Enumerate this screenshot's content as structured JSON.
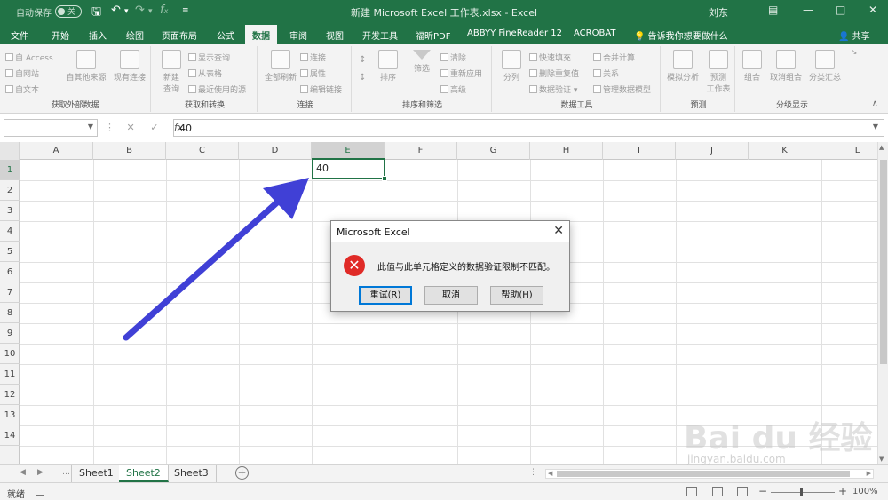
{
  "titlebar": {
    "autosave_label": "自动保存",
    "autosave_state": "关",
    "document_title": "新建 Microsoft Excel 工作表.xlsx  -  Excel",
    "user": "刘东",
    "icons": [
      "save-icon",
      "undo-icon",
      "redo-icon",
      "function-icon",
      "customize-icon"
    ]
  },
  "ribbon": {
    "tabs": [
      {
        "label": "文件"
      },
      {
        "label": "开始"
      },
      {
        "label": "插入"
      },
      {
        "label": "绘图"
      },
      {
        "label": "页面布局"
      },
      {
        "label": "公式"
      },
      {
        "label": "数据",
        "active": true
      },
      {
        "label": "审阅"
      },
      {
        "label": "视图"
      },
      {
        "label": "开发工具"
      },
      {
        "label": "福昕PDF"
      },
      {
        "label": "ABBYY FineReader 12"
      },
      {
        "label": "ACROBAT"
      }
    ],
    "tell_me": "告诉我你想要做什么",
    "share": "共享",
    "groups": {
      "external": {
        "label": "获取外部数据",
        "access": "自 Access",
        "web": "自网站",
        "text": "自文本",
        "other": "自其他来源",
        "existing": "现有连接"
      },
      "transform": {
        "label": "获取和转换",
        "new_query": "新建\n查询",
        "new_query_l1": "新建",
        "new_query_l2": "查询",
        "show_queries": "显示查询",
        "from_table": "从表格",
        "recent": "最近使用的源"
      },
      "connections": {
        "label": "连接",
        "refresh_all": "全部刷新",
        "connections": "连接",
        "properties": "属性",
        "edit_links": "编辑链接"
      },
      "sort": {
        "label": "排序和筛选",
        "sort": "排序",
        "filter": "筛选",
        "clear": "清除",
        "reapply": "重新应用",
        "advanced": "高级"
      },
      "tools": {
        "label": "数据工具",
        "split": "分列",
        "flash_fill": "快速填充",
        "remove_dup": "删除重复值",
        "validation": "数据验证",
        "consolidate": "合并计算",
        "relations": "关系",
        "data_model": "管理数据模型"
      },
      "forecast": {
        "label": "预测",
        "whatif": "模拟分析",
        "sheet_l1": "预测",
        "sheet_l2": "工作表"
      },
      "outline": {
        "label": "分级显示",
        "group": "组合",
        "ungroup": "取消组合",
        "subtotal": "分类汇总"
      }
    }
  },
  "formula_bar": {
    "name_box": "",
    "fx": "fx",
    "value": "40"
  },
  "grid": {
    "columns": [
      "A",
      "B",
      "C",
      "D",
      "E",
      "F",
      "G",
      "H",
      "I",
      "J",
      "K",
      "L"
    ],
    "rows": [
      "1",
      "2",
      "3",
      "4",
      "5",
      "6",
      "7",
      "8",
      "9",
      "10",
      "11",
      "12",
      "13",
      "14"
    ],
    "active_cell_value": "40",
    "selected_column": "E"
  },
  "sheets": {
    "tabs": [
      "Sheet1",
      "Sheet2",
      "Sheet3"
    ],
    "active": "Sheet2",
    "add": "+"
  },
  "status": {
    "ready": "就绪",
    "zoom": "100%"
  },
  "dialog": {
    "title": "Microsoft Excel",
    "message": "此值与此单元格定义的数据验证限制不匹配。",
    "buttons": {
      "retry": "重试(R)",
      "cancel": "取消",
      "help": "帮助(H)"
    },
    "icon": "error-icon"
  },
  "annotation": {
    "arrow_color": "#4040d6"
  },
  "watermark": {
    "text": "Bai du 经验",
    "url": "jingyan.baidu.com"
  },
  "colors": {
    "excel_green": "#217346",
    "error_red": "#e02b27"
  }
}
